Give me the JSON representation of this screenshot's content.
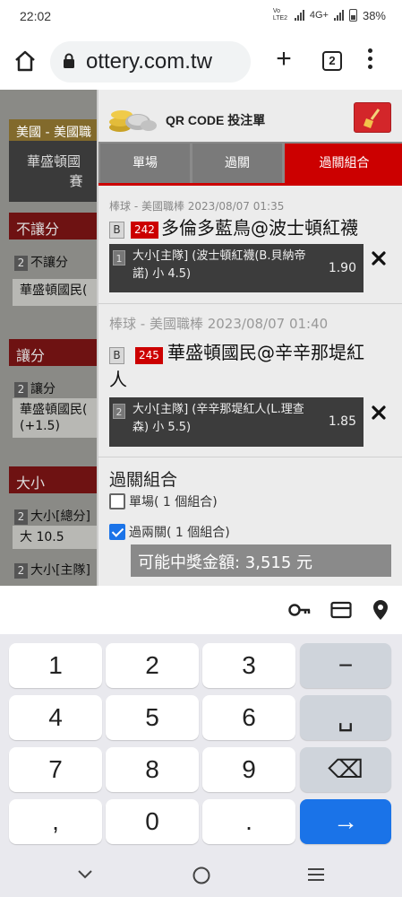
{
  "status_bar": {
    "time": "22:02",
    "network_label": "Vo LTE2",
    "net_type": "4G+",
    "battery": "38%"
  },
  "browser": {
    "url": "ottery.com.tw",
    "tab_count": "2"
  },
  "background_page": {
    "league": "美國 - 美國職",
    "match_line1": "華盛頓國",
    "match_line2": "賽",
    "sections": [
      {
        "title": "不讓分",
        "row_num": "2",
        "row_label": "不讓分",
        "value": "華盛頓國民("
      },
      {
        "title": "讓分",
        "row_num": "2",
        "row_label": "讓分",
        "value": "華盛頓國民(",
        "value2": "(+1.5)"
      },
      {
        "title": "大小",
        "row_num": "2",
        "row_label": "大小[總分]",
        "value": "大 10.5",
        "row_num2": "2",
        "row_label2": "大小[主隊]"
      }
    ]
  },
  "slip": {
    "title": "QR CODE 投注單",
    "tabs": [
      "單場",
      "過關",
      "過關組合"
    ],
    "active_tab": 2,
    "bets": [
      {
        "header": "棒球 - 美國職棒 2023/08/07 01:35",
        "type_badge": "B",
        "game_no": "242",
        "teams": "多倫多藍鳥@波士頓紅襪",
        "sel_no": "1",
        "selection_line1": "大小[主隊] (波士頓紅襪(B.貝納帝",
        "selection_line2": "諾) 小 4.5)",
        "odds": "1.90"
      },
      {
        "header": "棒球 - 美國職棒 2023/08/07 01:40",
        "type_badge": "B",
        "game_no": "245",
        "teams_line1": "華盛頓國民@辛辛那堤紅",
        "teams_line2": "人",
        "sel_no": "2",
        "selection_line1": "大小[主隊] (辛辛那堤紅人(L.理查",
        "selection_line2": "森) 小 5.5)",
        "odds": "1.85"
      }
    ],
    "combo_title": "過關組合",
    "options": [
      {
        "label": "單場( 1 個組合)",
        "checked": false
      },
      {
        "label": "過兩關( 1 個組合)",
        "checked": true
      }
    ],
    "payout_label": "可能中獎金額: 3,515 元"
  },
  "keyboard": {
    "rows": [
      [
        "1",
        "2",
        "3",
        "−"
      ],
      [
        "4",
        "5",
        "6",
        "␣"
      ],
      [
        "7",
        "8",
        "9",
        "⌫"
      ],
      [
        ",",
        "0",
        ".",
        "→"
      ]
    ]
  },
  "colors": {
    "accent_red": "#cc0000",
    "brand_blue": "#1a73e8"
  }
}
